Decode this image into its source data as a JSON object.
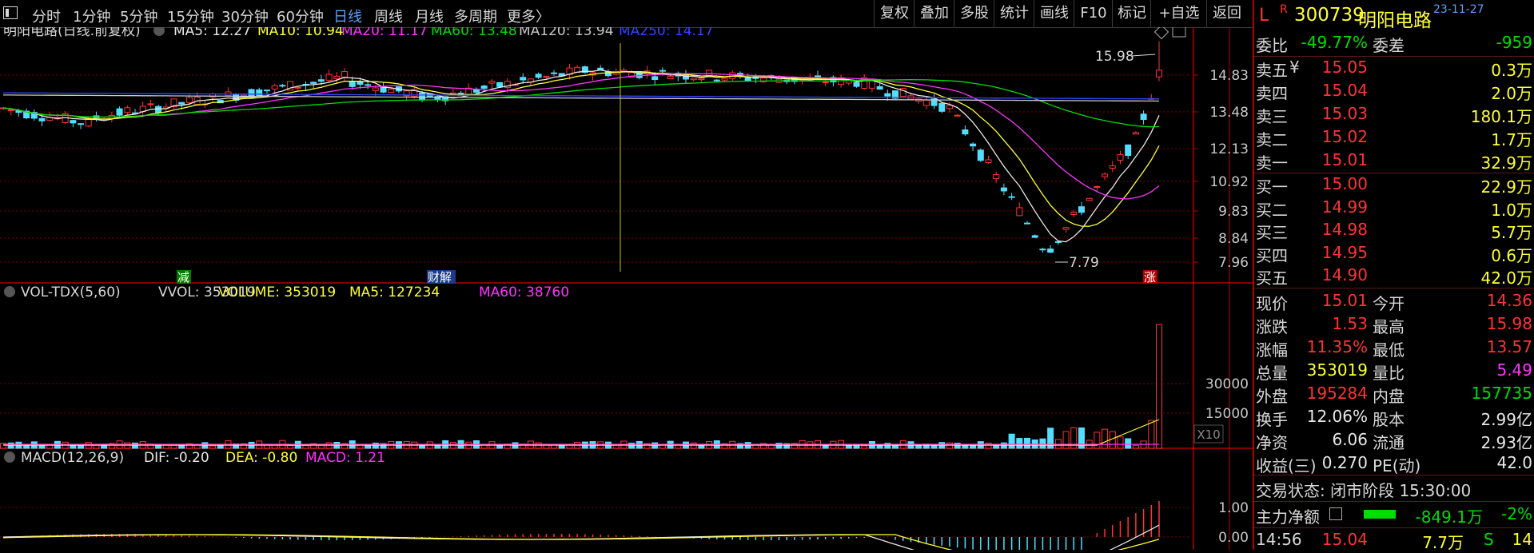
{
  "toolbar": {
    "periods": [
      "分时",
      "1分钟",
      "5分钟",
      "15分钟",
      "30分钟",
      "60分钟",
      "日线",
      "周线",
      "月线",
      "多周期",
      "更多〉"
    ],
    "active_period": "日线",
    "right_buttons": [
      "复权",
      "叠加",
      "多股",
      "统计",
      "画线",
      "F10",
      "标记",
      "+自选",
      "返回"
    ]
  },
  "main_legend": {
    "title": "明阳电路(日线.前复权)",
    "ma": [
      {
        "label": "MA5: 12.27",
        "color": "#e8e8e8"
      },
      {
        "label": "MA10: 10.94",
        "color": "#ffff33"
      },
      {
        "label": "MA20: 11.17",
        "color": "#ff33ff"
      },
      {
        "label": "MA60: 13.48",
        "color": "#00dd00"
      },
      {
        "label": "MA120: 13.94",
        "color": "#c8c8c8"
      },
      {
        "label": "MA250: 14.17",
        "color": "#3344ff"
      }
    ]
  },
  "price_axis": [
    "14.83",
    "13.48",
    "12.13",
    "10.92",
    "9.83",
    "8.84",
    "7.96"
  ],
  "annotations": {
    "high": "15.98",
    "low": "7.79",
    "mark_jian": "减",
    "mark_caijie": "财解",
    "mark_zhang": "涨"
  },
  "vol_legend": {
    "items": [
      {
        "label": "VOL-TDX(5,60)",
        "color": "#d8d8d8"
      },
      {
        "label": "VVOL: 353019",
        "color": "#d8d8d8"
      },
      {
        "label": "VOLUME: 353019",
        "color": "#ffff33"
      },
      {
        "label": "MA5: 127234",
        "color": "#ffff33"
      },
      {
        "label": "MA60: 38760",
        "color": "#ff33ff"
      }
    ],
    "axis": [
      "30000",
      "15000"
    ],
    "unit": "X10"
  },
  "macd_legend": {
    "items": [
      {
        "label": "MACD(12,26,9)",
        "color": "#d8d8d8"
      },
      {
        "label": "DIF: -0.20",
        "color": "#e8e8e8"
      },
      {
        "label": "DEA: -0.80",
        "color": "#ffff33"
      },
      {
        "label": "MACD: 1.21",
        "color": "#ff33ff"
      }
    ],
    "axis": [
      "1.00",
      "0.00"
    ]
  },
  "stock": {
    "prefix": "L",
    "badge": "R",
    "code": "300739",
    "name": "明阳电路",
    "date": "23-11-27"
  },
  "ratio": {
    "label": "委比",
    "value": "-49.77%",
    "diff_label": "委差",
    "diff": "-959"
  },
  "asks": [
    {
      "label": "卖五",
      "price": "15.05",
      "vol": "0.3万",
      "mark": "¥"
    },
    {
      "label": "卖四",
      "price": "15.04",
      "vol": "2.0万"
    },
    {
      "label": "卖三",
      "price": "15.03",
      "vol": "180.1万"
    },
    {
      "label": "卖二",
      "price": "15.02",
      "vol": "1.7万"
    },
    {
      "label": "卖一",
      "price": "15.01",
      "vol": "32.9万"
    }
  ],
  "bids": [
    {
      "label": "买一",
      "price": "15.00",
      "vol": "22.9万"
    },
    {
      "label": "买二",
      "price": "14.99",
      "vol": "1.0万"
    },
    {
      "label": "买三",
      "price": "14.98",
      "vol": "5.7万"
    },
    {
      "label": "买四",
      "price": "14.95",
      "vol": "0.6万"
    },
    {
      "label": "买五",
      "price": "14.90",
      "vol": "42.0万"
    }
  ],
  "stats": [
    {
      "l1": "现价",
      "v1": "15.01",
      "c1": "red",
      "l2": "今开",
      "v2": "14.36",
      "c2": "red"
    },
    {
      "l1": "涨跌",
      "v1": "1.53",
      "c1": "red",
      "l2": "最高",
      "v2": "15.98",
      "c2": "red"
    },
    {
      "l1": "涨幅",
      "v1": "11.35%",
      "c1": "red",
      "l2": "最低",
      "v2": "13.57",
      "c2": "red"
    },
    {
      "l1": "总量",
      "v1": "353019",
      "c1": "yellow",
      "l2": "量比",
      "v2": "5.49",
      "c2": "magenta"
    },
    {
      "l1": "外盘",
      "v1": "195284",
      "c1": "red",
      "l2": "内盘",
      "v2": "157735",
      "c2": "green"
    },
    {
      "l1": "换手",
      "v1": "12.06%",
      "c1": "white",
      "l2": "股本",
      "v2": "2.99亿",
      "c2": "white"
    },
    {
      "l1": "净资",
      "v1": "6.06",
      "c1": "white",
      "l2": "流通",
      "v2": "2.93亿",
      "c2": "white"
    },
    {
      "l1": "收益(三)",
      "v1": "0.270",
      "c1": "white",
      "l2": "PE(动)",
      "v2": "42.0",
      "c2": "white"
    }
  ],
  "trade_status": "交易状态: 闭市阶段 15:30:00",
  "main_force": {
    "label": "主力净额",
    "value": "-849.1万",
    "pct": "-2%"
  },
  "last_tick": {
    "time": "14:56",
    "price": "15.04",
    "vol": "7.7万",
    "side": "S",
    "num": "14"
  },
  "colors": {
    "up": "#ff3333",
    "down": "#55ddff",
    "bg": "#000000",
    "grid": "#7a0000",
    "accent": "#5aa0ff"
  }
}
